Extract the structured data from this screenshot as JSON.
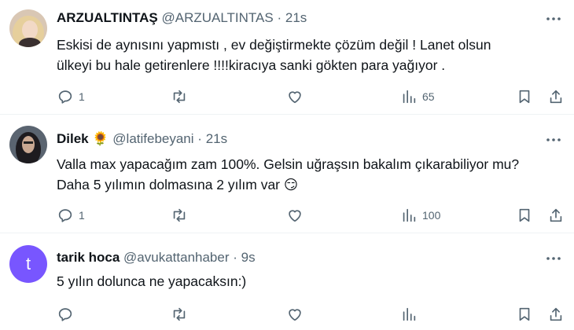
{
  "tweets": [
    {
      "name": "ARZUALTINTAŞ",
      "handle": "@ARZUALTINTAS",
      "separator": "·",
      "time": "21s",
      "text_line1": "Eskisi de aynısını yapmıstı , ev değiştirmekte çözüm değil ! Lanet olsun",
      "text_line2": "ülkeyi bu hale getirenlere !!!!kiracıya sanki gökten para yağıyor .",
      "reply_count": "1",
      "repost_count": "",
      "like_count": "",
      "view_count": "65"
    },
    {
      "name": "Dilek",
      "name_emoji": "🌻",
      "handle": "@latifebeyani",
      "separator": "·",
      "time": "21s",
      "text_line1": "Valla max yapacağım zam 100%. Gelsin uğraşsın bakalım çıkarabiliyor mu?",
      "text_line2": "Daha 5 yılımın dolmasına 2 yılım var",
      "text_emoji": "😏",
      "reply_count": "1",
      "repost_count": "",
      "like_count": "",
      "view_count": "100"
    },
    {
      "name": "tarik hoca",
      "handle": "@avukattanhaber",
      "separator": "·",
      "time": "9s",
      "avatar_letter": "t",
      "text_line1": "5 yılın dolunca ne yapacaksın:)",
      "reply_count": "",
      "repost_count": "",
      "like_count": "",
      "view_count": ""
    }
  ],
  "colors": {
    "text": "#0f1419",
    "secondary": "#536471",
    "divider": "#eff3f4",
    "avatar_purple": "#7856ff"
  }
}
